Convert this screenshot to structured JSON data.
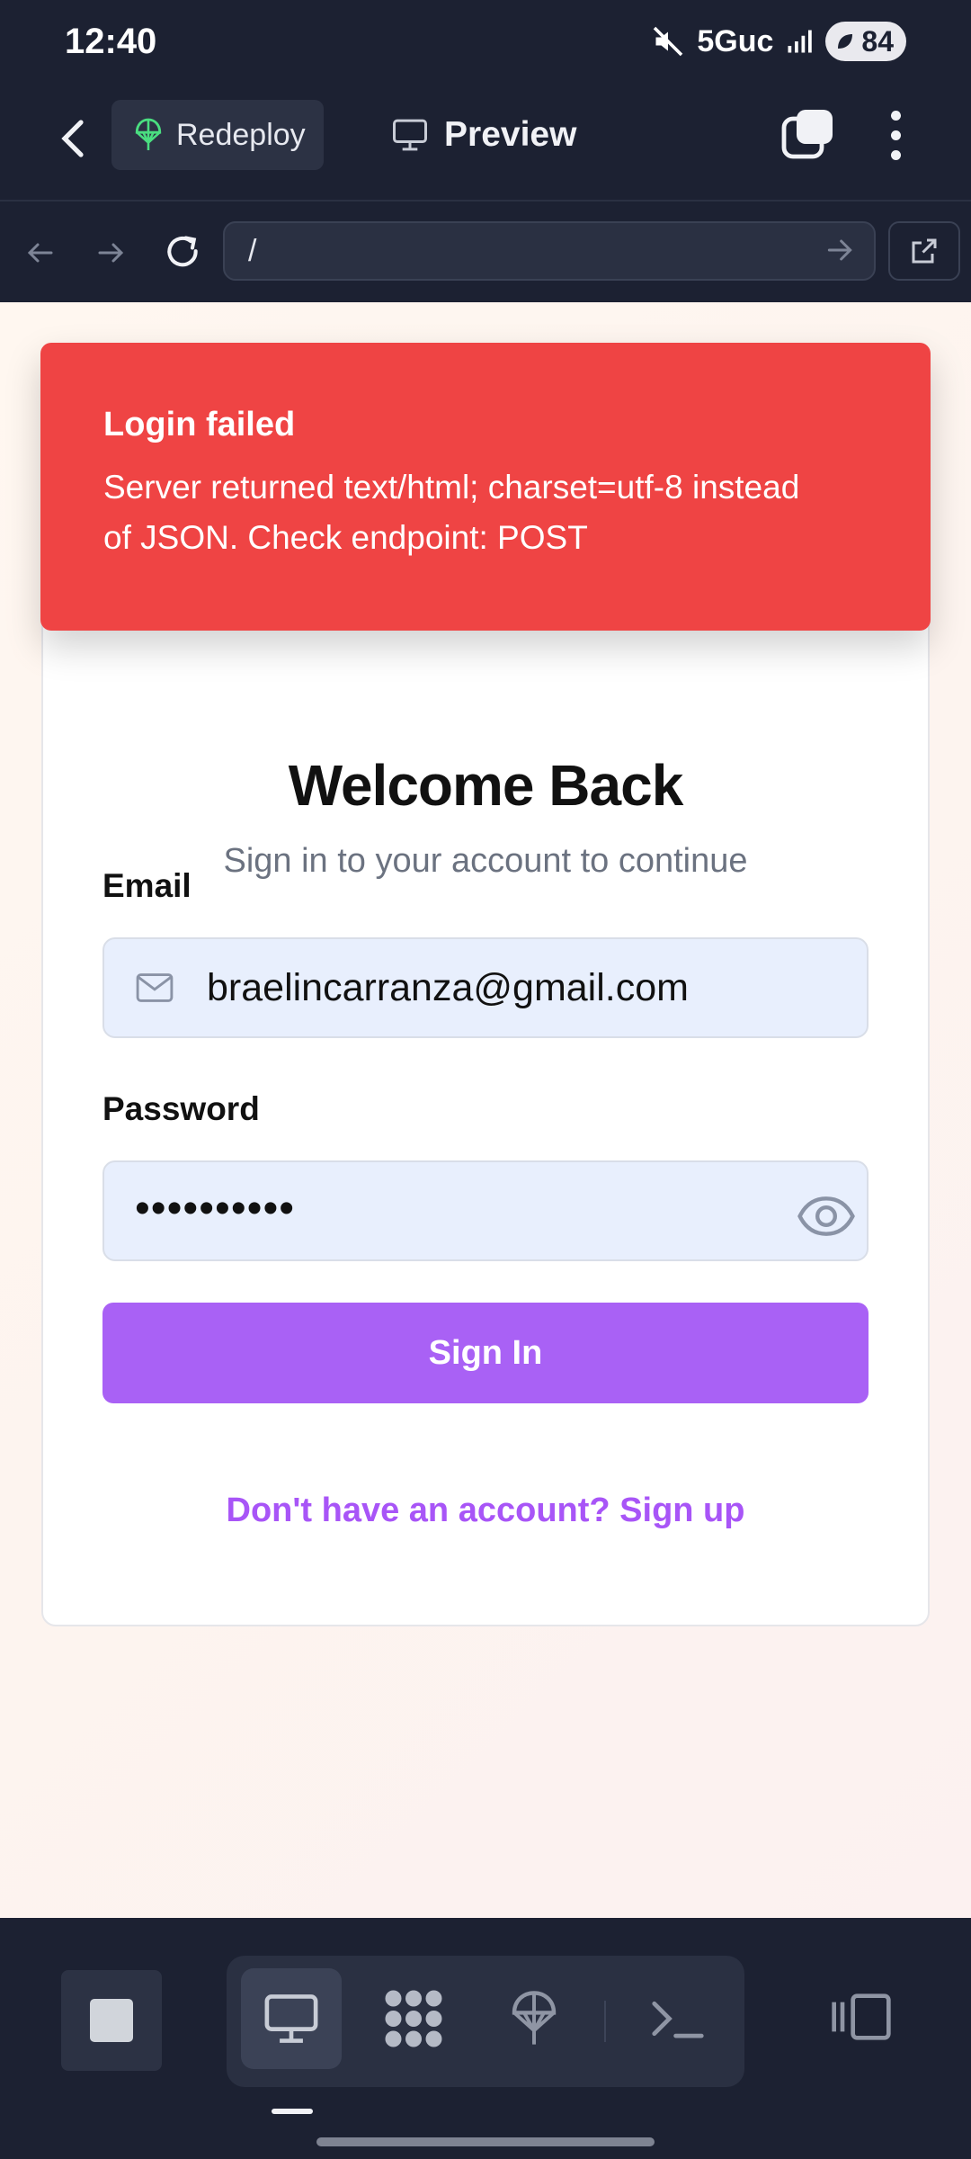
{
  "status_bar": {
    "time": "12:40",
    "network": "5Guc",
    "battery": "84",
    "icons": [
      "mute-icon",
      "signal-icon",
      "battery-icon"
    ]
  },
  "app_bar": {
    "back_icon": "chevron-left-icon",
    "redeploy_label": "Redeploy",
    "redeploy_icon": "deploy-icon",
    "preview_label": "Preview",
    "preview_icon": "monitor-icon",
    "tabs_icon": "tabs-icon",
    "more_icon": "more-vertical-icon"
  },
  "url_bar": {
    "url": "/",
    "back_icon": "arrow-left-icon",
    "forward_icon": "arrow-right-icon",
    "reload_icon": "reload-icon",
    "go_icon": "arrow-right-icon",
    "open_external_icon": "external-link-icon"
  },
  "toast": {
    "title": "Login failed",
    "message": "Server returned text/html; charset=utf-8 instead of JSON. Check endpoint: POST",
    "color": "#ef4444"
  },
  "login": {
    "title": "Welcome Back",
    "subtitle": "Sign in to your account to continue",
    "email_label": "Email",
    "email_value": "braelincarranza@gmail.com",
    "password_label": "Password",
    "password_value": "••••••••••",
    "signin_label": "Sign In",
    "signup_text": "Don't have an account? Sign up",
    "accent_color": "#a961f5"
  },
  "bottom_bar": {
    "tools": [
      "stop-icon",
      "monitor-icon",
      "nodes-icon",
      "deploy-icon",
      "terminal-icon",
      "layout-icon"
    ],
    "active_tool": "monitor-icon"
  }
}
